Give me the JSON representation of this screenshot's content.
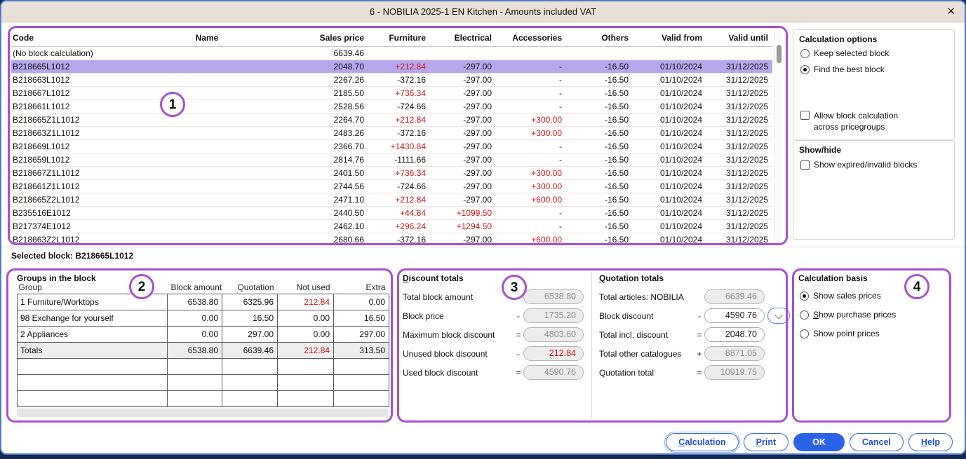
{
  "window": {
    "title": "6 - NOBILIA 2025-1 EN Kitchen - Amounts included VAT",
    "close_icon": "✕"
  },
  "colors": {
    "accent_blue": "#2b63e8",
    "selected_row": "#b6a6ec",
    "negative_red": "#cc1414",
    "annotation_purple": "#a850cf",
    "titlebar_beige": "#e8e0d6"
  },
  "block_table": {
    "columns": [
      "Code",
      "Name",
      "Sales price",
      "Furniture",
      "Electrical",
      "Accessories",
      "Others",
      "Valid from",
      "Valid until"
    ],
    "rows": [
      {
        "cells": [
          "(No block calculation)",
          "",
          "6639.46",
          "",
          "",
          "",
          "",
          "",
          ""
        ],
        "red": [],
        "selected": false
      },
      {
        "cells": [
          "B218665L1012",
          "",
          "2048.70",
          "+212.84",
          "-297.00",
          "-",
          "-16.50",
          "01/10/2024",
          "31/12/2025"
        ],
        "red": [
          3
        ],
        "selected": true
      },
      {
        "cells": [
          "B218663L1012",
          "",
          "2267.26",
          "-372.16",
          "-297.00",
          "-",
          "-16.50",
          "01/10/2024",
          "31/12/2025"
        ],
        "red": [],
        "selected": false
      },
      {
        "cells": [
          "B218667L1012",
          "",
          "2185.50",
          "+736.34",
          "-297.00",
          "-",
          "-16.50",
          "01/10/2024",
          "31/12/2025"
        ],
        "red": [
          3
        ],
        "selected": false
      },
      {
        "cells": [
          "B218661L1012",
          "",
          "2528.56",
          "-724.66",
          "-297.00",
          "-",
          "-16.50",
          "01/10/2024",
          "31/12/2025"
        ],
        "red": [],
        "selected": false
      },
      {
        "cells": [
          "B218665Z1L1012",
          "",
          "2264.70",
          "+212.84",
          "-297.00",
          "+300.00",
          "-16.50",
          "01/10/2024",
          "31/12/2025"
        ],
        "red": [
          3,
          5
        ],
        "selected": false
      },
      {
        "cells": [
          "B218663Z1L1012",
          "",
          "2483.26",
          "-372.16",
          "-297.00",
          "+300.00",
          "-16.50",
          "01/10/2024",
          "31/12/2025"
        ],
        "red": [
          5
        ],
        "selected": false
      },
      {
        "cells": [
          "B218669L1012",
          "",
          "2366.70",
          "+1430.84",
          "-297.00",
          "-",
          "-16.50",
          "01/10/2024",
          "31/12/2025"
        ],
        "red": [
          3
        ],
        "selected": false
      },
      {
        "cells": [
          "B218659L1012",
          "",
          "2814.76",
          "-1111.66",
          "-297.00",
          "-",
          "-16.50",
          "01/10/2024",
          "31/12/2025"
        ],
        "red": [],
        "selected": false
      },
      {
        "cells": [
          "B218667Z1L1012",
          "",
          "2401.50",
          "+736.34",
          "-297.00",
          "+300.00",
          "-16.50",
          "01/10/2024",
          "31/12/2025"
        ],
        "red": [
          3,
          5
        ],
        "selected": false
      },
      {
        "cells": [
          "B218661Z1L1012",
          "",
          "2744.56",
          "-724.66",
          "-297.00",
          "+300.00",
          "-16.50",
          "01/10/2024",
          "31/12/2025"
        ],
        "red": [
          5
        ],
        "selected": false
      },
      {
        "cells": [
          "B218665Z2L1012",
          "",
          "2471.10",
          "+212.84",
          "-297.00",
          "+600.00",
          "-16.50",
          "01/10/2024",
          "31/12/2025"
        ],
        "red": [
          3,
          5
        ],
        "selected": false
      },
      {
        "cells": [
          "B235516E1012",
          "",
          "2440.50",
          "+44.84",
          "+1099.50",
          "-",
          "-16.50",
          "01/10/2024",
          "31/12/2025"
        ],
        "red": [
          3,
          4
        ],
        "selected": false
      },
      {
        "cells": [
          "B217374E1012",
          "",
          "2462.10",
          "+296.24",
          "+1294.50",
          "-",
          "-16.50",
          "01/10/2024",
          "31/12/2025"
        ],
        "red": [
          3,
          4
        ],
        "selected": false
      },
      {
        "cells": [
          "B218663Z2L1012",
          "",
          "2680.66",
          "-372.16",
          "-297.00",
          "+600.00",
          "-16.50",
          "01/10/2024",
          "31/12/2025"
        ],
        "red": [
          5
        ],
        "selected": false
      }
    ]
  },
  "calculation_options": {
    "title": "Calculation options",
    "radios": [
      {
        "label": "Keep selected block",
        "selected": false,
        "accel": ""
      },
      {
        "label": "Find the best block",
        "selected": true,
        "accel": ""
      }
    ],
    "checkbox": {
      "label": "Allow block calculation across pricegroups",
      "checked": false
    }
  },
  "show_hide": {
    "title": "Show/hide",
    "checkbox": {
      "label": "Show expired/invalid blocks",
      "checked": false
    }
  },
  "selected_block": {
    "text": "Selected block: B218665L1012"
  },
  "groups_panel": {
    "title": "Groups in the block",
    "columns": [
      "Group",
      "Block amount",
      "Quotation",
      "Not used",
      "Extra"
    ],
    "rows": [
      {
        "cells": [
          "1 Furniture/Worktops",
          "6538.80",
          "6325.96",
          "212.84",
          "0.00"
        ],
        "red": [
          3
        ],
        "totals": false
      },
      {
        "cells": [
          "98 Exchange for yourself",
          "0.00",
          "16.50",
          "0.00",
          "16.50"
        ],
        "red": [],
        "totals": false
      },
      {
        "cells": [
          "2 Appliances",
          "0.00",
          "297.00",
          "0.00",
          "297.00"
        ],
        "red": [],
        "totals": false
      },
      {
        "cells": [
          "Totals",
          "6538.80",
          "6639.46",
          "212.84",
          "313.50"
        ],
        "red": [
          3
        ],
        "totals": true
      },
      {
        "cells": [
          "",
          "",
          "",
          "",
          ""
        ],
        "red": [],
        "totals": false
      },
      {
        "cells": [
          "",
          "",
          "",
          "",
          ""
        ],
        "red": [],
        "totals": false
      },
      {
        "cells": [
          "",
          "",
          "",
          "",
          ""
        ],
        "red": [],
        "totals": false
      }
    ]
  },
  "discount_totals": {
    "title": "Discount totals",
    "accel": "D",
    "rows": [
      {
        "label": "Total block amount",
        "op": "",
        "value": "6538.80",
        "style": "gray",
        "dropdown": false
      },
      {
        "label": "Block price",
        "op": "-",
        "value": "1735.20",
        "style": "gray",
        "dropdown": false
      },
      {
        "label": "Maximum block discount",
        "op": "=",
        "value": "4803.60",
        "style": "gray",
        "dropdown": false
      },
      {
        "label": "Unused block discount",
        "op": "-",
        "value": "212.84",
        "style": "redv",
        "dropdown": false
      },
      {
        "label": "Used block discount",
        "op": "=",
        "value": "4590.76",
        "style": "gray",
        "dropdown": false
      }
    ]
  },
  "quotation_totals": {
    "title": "Quotation totals",
    "accel": "Q",
    "rows": [
      {
        "label": "Total articles: NOBILIA",
        "op": "",
        "value": "6639.46",
        "style": "gray",
        "dropdown": false
      },
      {
        "label": "Block discount",
        "op": "-",
        "value": "4590.76",
        "style": "white",
        "dropdown": true
      },
      {
        "label": "Total incl. discount",
        "op": "=",
        "value": "2048.70",
        "style": "white",
        "dropdown": false
      },
      {
        "label": "Total other catalogues",
        "op": "+",
        "value": "8871.05",
        "style": "gray",
        "dropdown": false
      },
      {
        "label": "Quotation total",
        "op": "=",
        "value": "10919.75",
        "style": "gray",
        "dropdown": false
      }
    ]
  },
  "calculation_basis": {
    "title": "Calculation basis",
    "radios": [
      {
        "label": "Show sales prices",
        "selected": true,
        "accel": ""
      },
      {
        "label": "Show purchase prices",
        "selected": false,
        "accel": "S"
      },
      {
        "label": "Show point prices",
        "selected": false,
        "accel": ""
      }
    ]
  },
  "buttons": [
    {
      "label": "Calculation",
      "accel": "C",
      "style": "outline",
      "focused": true
    },
    {
      "label": "Print",
      "accel": "P",
      "style": "outline",
      "focused": false
    },
    {
      "label": "OK",
      "accel": "",
      "style": "primary",
      "focused": false
    },
    {
      "label": "Cancel",
      "accel": "",
      "style": "outline",
      "focused": false
    },
    {
      "label": "Help",
      "accel": "H",
      "style": "outline",
      "focused": false
    }
  ],
  "annotations": {
    "labels": [
      "1",
      "2",
      "3",
      "4"
    ]
  }
}
